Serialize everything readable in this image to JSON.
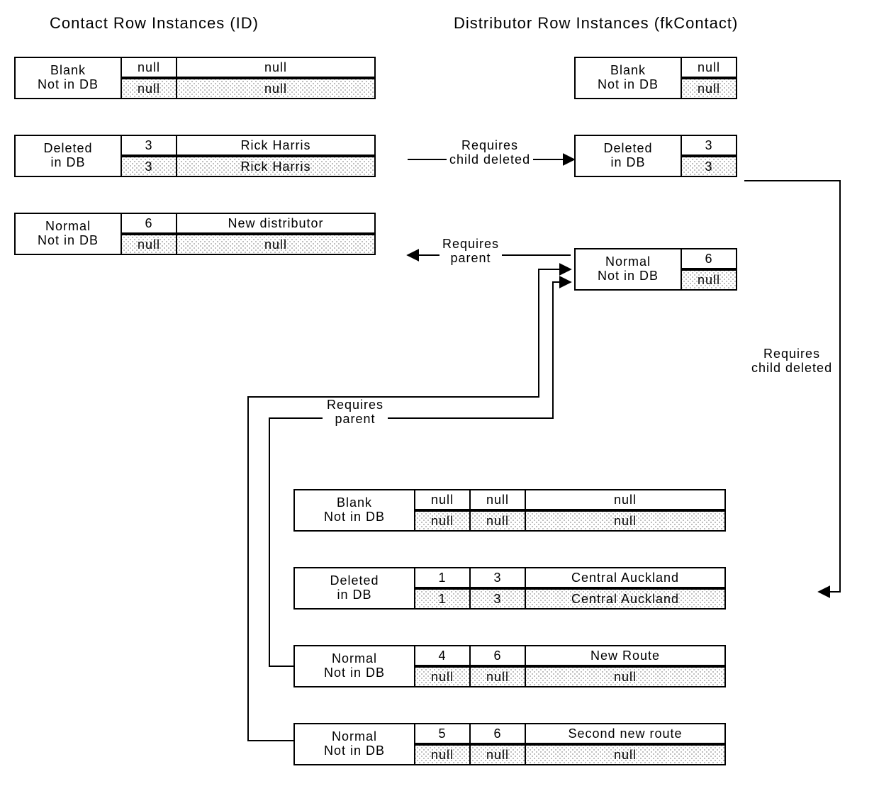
{
  "headings": {
    "contact": "Contact Row Instances (ID)",
    "distributor": "Distributor Row Instances (fkContact)"
  },
  "status": {
    "blank": {
      "l1": "Blank",
      "l2": "Not in DB"
    },
    "deleted": {
      "l1": "Deleted",
      "l2": "in DB"
    },
    "normal": {
      "l1": "Normal",
      "l2": "Not in DB"
    }
  },
  "edges": {
    "req_child_deleted": "Requires\nchild deleted",
    "req_parent": "Requires\nparent"
  },
  "contact": {
    "blank": {
      "top": [
        "null",
        "null"
      ],
      "bottom": [
        "null",
        "null"
      ]
    },
    "deleted": {
      "top": [
        "3",
        "Rick Harris"
      ],
      "bottom": [
        "3",
        "Rick Harris"
      ]
    },
    "normal": {
      "top": [
        "6",
        "New distributor"
      ],
      "bottom": [
        "null",
        "null"
      ]
    }
  },
  "distributor": {
    "blank": {
      "top": [
        "null"
      ],
      "bottom": [
        "null"
      ]
    },
    "deleted": {
      "top": [
        "3"
      ],
      "bottom": [
        "3"
      ]
    },
    "normal": {
      "top": [
        "6"
      ],
      "bottom": [
        "null"
      ]
    }
  },
  "routes": {
    "blank": {
      "top": [
        "null",
        "null",
        "null"
      ],
      "bottom": [
        "null",
        "null",
        "null"
      ]
    },
    "deleted": {
      "top": [
        "1",
        "3",
        "Central Auckland"
      ],
      "bottom": [
        "1",
        "3",
        "Central Auckland"
      ]
    },
    "normal1": {
      "top": [
        "4",
        "6",
        "New Route"
      ],
      "bottom": [
        "null",
        "null",
        "null"
      ]
    },
    "normal2": {
      "top": [
        "5",
        "6",
        "Second new route"
      ],
      "bottom": [
        "null",
        "null",
        "null"
      ]
    }
  }
}
